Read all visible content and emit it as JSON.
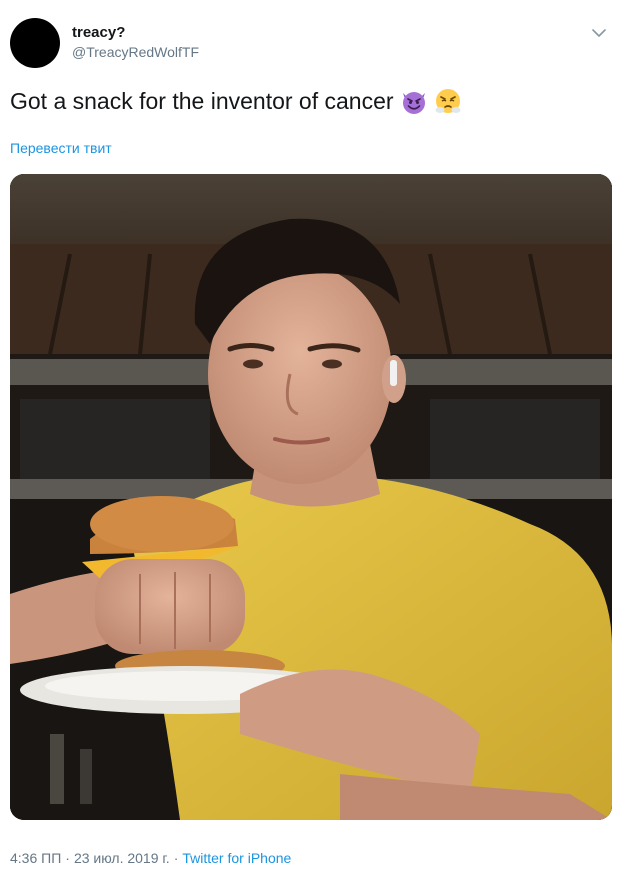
{
  "user": {
    "display_name": "treacy?",
    "handle": "@TreacyRedWolfTF"
  },
  "tweet": {
    "text": "Got a snack for the inventor of cancer",
    "emojis": [
      "smiling-devil-emoji",
      "steam-from-nose-emoji"
    ],
    "translate_label": "Перевести твит"
  },
  "meta": {
    "time": "4:36 ПП",
    "separator": "·",
    "date": "23 июл. 2019 г.",
    "source": "Twitter for iPhone"
  },
  "colors": {
    "link": "#1b95e0",
    "muted": "#657786",
    "text": "#14171a"
  }
}
